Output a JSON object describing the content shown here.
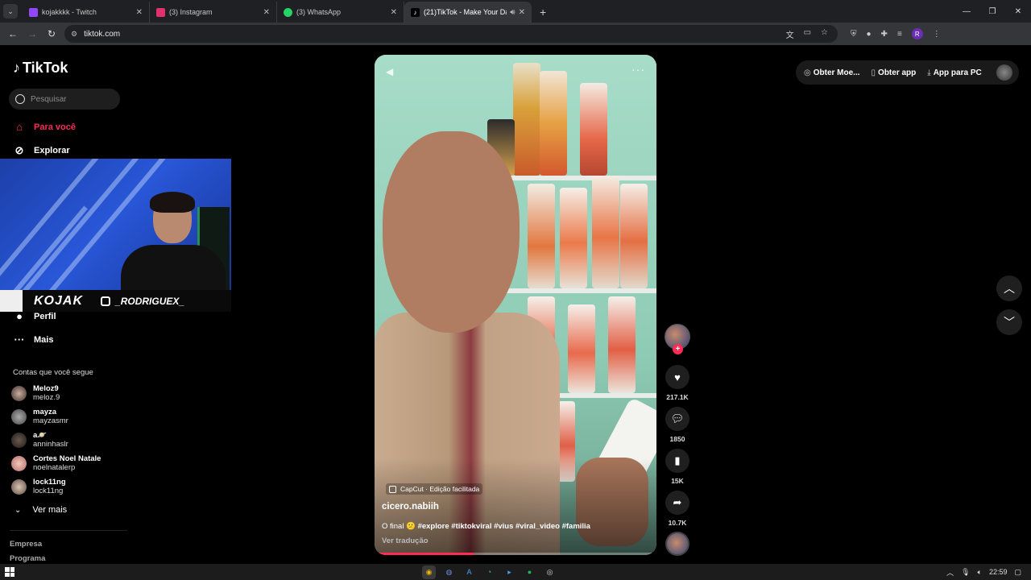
{
  "browser": {
    "tabs": [
      {
        "label": "kojakkkk - Twitch",
        "favicon_color": "#9146ff",
        "active": false
      },
      {
        "label": "(3) Instagram",
        "favicon_color": "#e1306c",
        "active": false
      },
      {
        "label": "(3) WhatsApp",
        "favicon_color": "#25d366",
        "active": false
      },
      {
        "label": "(21)TikTok - Make Your Day",
        "favicon_color": "#000000",
        "active": true
      }
    ],
    "url": "tiktok.com"
  },
  "sidebar": {
    "logo": "TikTok",
    "search_placeholder": "Pesquisar",
    "nav": {
      "for_you": "Para você",
      "explore": "Explorar",
      "profile": "Perfil",
      "more": "Mais"
    },
    "following_header": "Contas que você segue",
    "accounts": [
      {
        "name": "Meloz9",
        "handle": "meloz.9"
      },
      {
        "name": "mayza",
        "handle": "mayzasmr"
      },
      {
        "name": "a🪐",
        "handle": "anninhaslr"
      },
      {
        "name": "Cortes Noel Natale",
        "handle": "noelnatalerp"
      },
      {
        "name": "lock11ng",
        "handle": "lock11ng"
      }
    ],
    "see_more": "Ver mais",
    "footer": [
      "Empresa",
      "Programa"
    ]
  },
  "overlay": {
    "signature": "KOJAK",
    "instagram": "_RODRIGUEX_"
  },
  "video": {
    "capcut": "CapCut · Edição facilitada",
    "author": "cicero.nabiih",
    "caption_text": "O final 😕",
    "caption_tags": "#explore #tiktokviral #vius #viral_video #familia",
    "translate": "Ver tradução",
    "progress": 0.35
  },
  "actions": {
    "likes": "217.1K",
    "comments": "1850",
    "saves": "15K",
    "shares": "10.7K"
  },
  "topbar": {
    "get_coins": "Obter Moe...",
    "get_app": "Obter app",
    "pc_app": "App para PC"
  },
  "taskbar": {
    "time": "22:59"
  }
}
